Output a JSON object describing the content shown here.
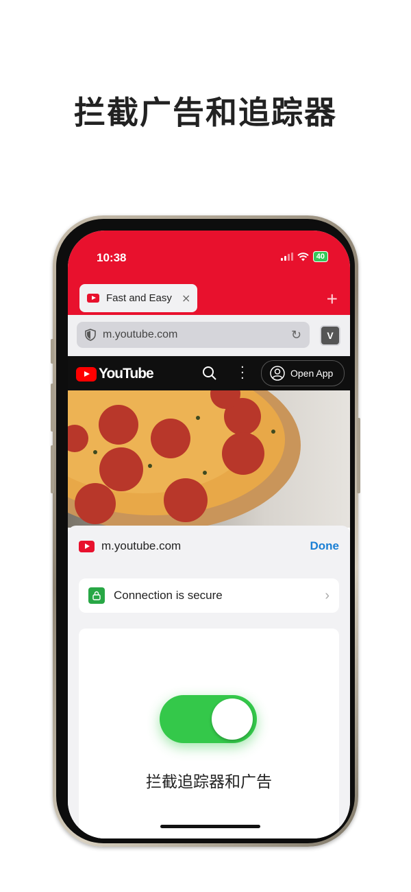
{
  "headline": "拦截广告和追踪器",
  "status_bar": {
    "time": "10:38",
    "battery": "40"
  },
  "tab": {
    "title": "Fast and Easy",
    "close": "×"
  },
  "new_tab": "+",
  "address_bar": {
    "url": "m.youtube.com",
    "reload": "↻"
  },
  "vivaldi_button": "V",
  "youtube": {
    "logo_text": "YouTube",
    "open_app": "Open App"
  },
  "site_sheet": {
    "domain": "m.youtube.com",
    "done": "Done",
    "connection": "Connection is secure",
    "chevron": "›",
    "toggle_state": "on",
    "toggle_label": "拦截追踪器和广告"
  },
  "colors": {
    "accent": "#e8112d",
    "toggle": "#34c84a",
    "link": "#1a7fd4"
  },
  "icons": [
    "shield-icon",
    "reload-icon",
    "vivaldi-icon",
    "search-icon",
    "more-icon",
    "account-icon",
    "lock-icon",
    "chevron-right-icon"
  ]
}
